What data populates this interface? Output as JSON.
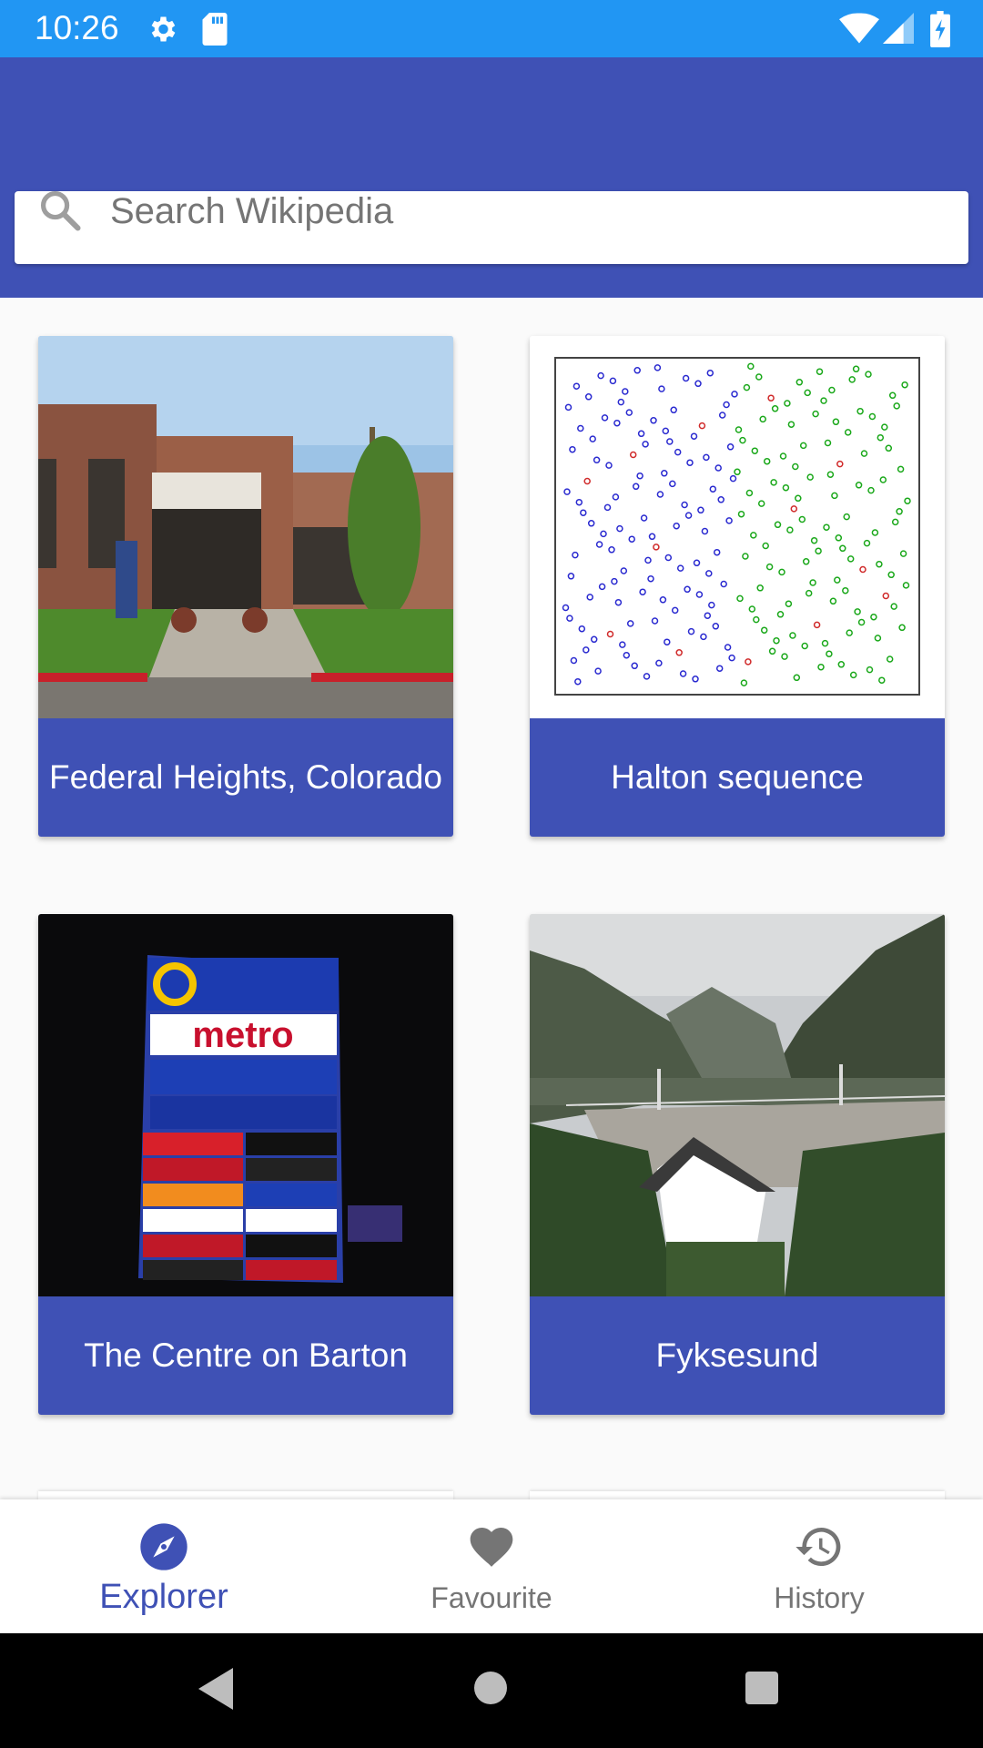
{
  "status_bar": {
    "time": "10:26",
    "icons": [
      "gear-icon",
      "sd-card-icon",
      "wifi-icon",
      "signal-icon",
      "battery-charging-icon"
    ]
  },
  "search": {
    "placeholder": "Search Wikipedia",
    "icon": "search-icon"
  },
  "cards": [
    {
      "title": "Federal Heights, Colorado",
      "image": "municipal-building-photo"
    },
    {
      "title": "Halton sequence",
      "image": "halton-sequence-plot"
    },
    {
      "title": "The Centre on Barton",
      "image": "mall-sign-photo"
    },
    {
      "title": "Fyksesund",
      "image": "fjord-photo"
    }
  ],
  "bottom_nav": {
    "items": [
      {
        "label": "Explorer",
        "icon": "compass-icon",
        "active": true
      },
      {
        "label": "Favourite",
        "icon": "heart-icon",
        "active": false
      },
      {
        "label": "History",
        "icon": "history-icon",
        "active": false
      }
    ]
  },
  "colors": {
    "status_bar": "#2196f3",
    "primary": "#3f51b5",
    "background": "#fafafa"
  }
}
